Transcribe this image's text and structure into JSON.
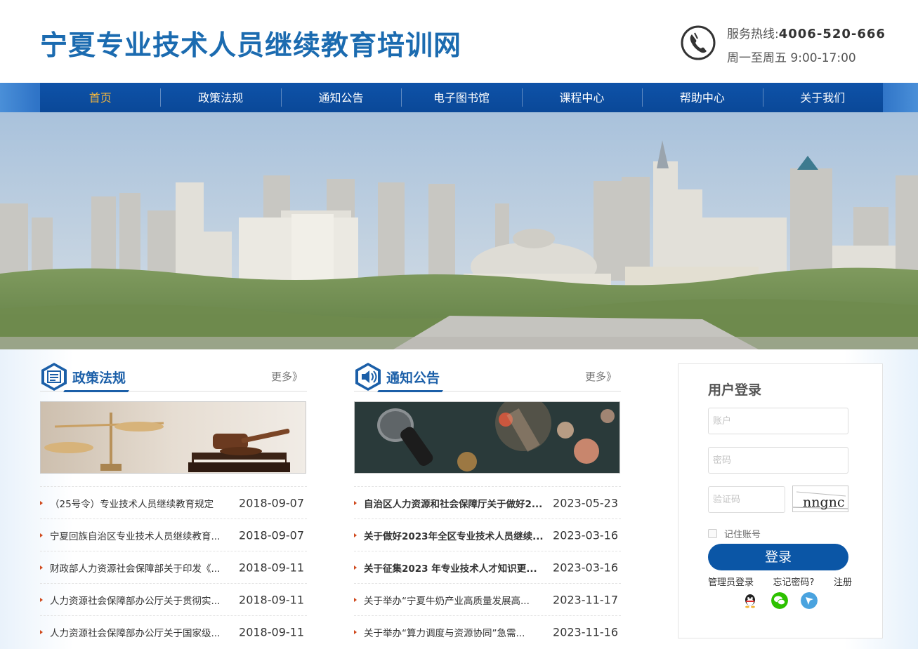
{
  "header": {
    "title": "宁夏专业技术人员继续教育培训网",
    "hotline_label": "服务热线:",
    "hotline_number": "4006-520-666",
    "hours": "周一至周五 9:00-17:00"
  },
  "nav": {
    "items": [
      {
        "label": "首页",
        "active": true
      },
      {
        "label": "政策法规"
      },
      {
        "label": "通知公告"
      },
      {
        "label": "电子图书馆"
      },
      {
        "label": "课程中心"
      },
      {
        "label": "帮助中心"
      },
      {
        "label": "关于我们"
      }
    ]
  },
  "policy": {
    "title": "政策法规",
    "more": "更多》",
    "items": [
      {
        "title": "（25号令）专业技术人员继续教育规定",
        "date": "2018-09-07"
      },
      {
        "title": "宁夏回族自治区专业技术人员继续教育...",
        "date": "2018-09-07"
      },
      {
        "title": "财政部人力资源社会保障部关于印发《...",
        "date": "2018-09-11"
      },
      {
        "title": "人力资源社会保障部办公厅关于贯彻实...",
        "date": "2018-09-11"
      },
      {
        "title": "人力资源社会保障部办公厅关于国家级...",
        "date": "2018-09-11"
      }
    ]
  },
  "notice": {
    "title": "通知公告",
    "more": "更多》",
    "items": [
      {
        "title": "自治区人力资源和社会保障厅关于做好2...",
        "date": "2023-05-23"
      },
      {
        "title": "关于做好2023年全区专业技术人员继续...",
        "date": "2023-03-16"
      },
      {
        "title": "关于征集2023 年专业技术人才知识更...",
        "date": "2023-03-16"
      },
      {
        "title": "关于举办“宁夏牛奶产业高质量发展高...",
        "date": "2023-11-17"
      },
      {
        "title": "关于举办“算力调度与资源协同”急需...",
        "date": "2023-11-16"
      }
    ]
  },
  "login": {
    "title": "用户登录",
    "account_placeholder": "账户",
    "password_placeholder": "密码",
    "captcha_placeholder": "验证码",
    "captcha_text": "nngnc",
    "remember": "记住账号",
    "submit": "登录",
    "admin_login": "管理员登录",
    "forgot": "忘记密码?",
    "register": "注册"
  },
  "colors": {
    "brand_blue": "#0b56a6",
    "nav_active": "#f5b73c",
    "bullet": "#d04a1e"
  },
  "icons": {
    "phone": "phone-icon",
    "policy": "newspaper-icon",
    "notice": "speaker-icon",
    "social": [
      "qq-icon",
      "wechat-icon",
      "weibo-icon"
    ]
  }
}
